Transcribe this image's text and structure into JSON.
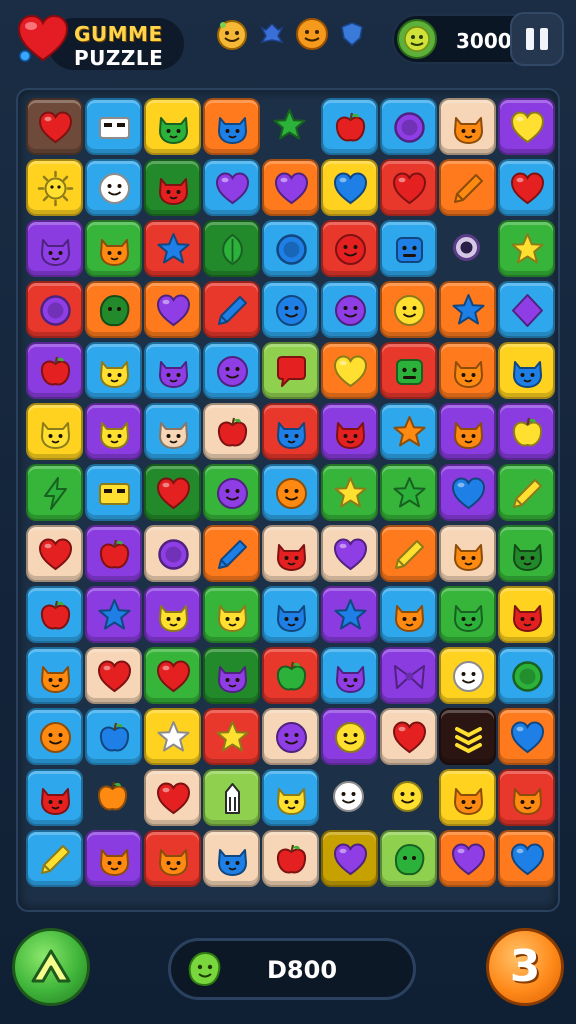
{
  "header": {
    "logo_line1": "GUMME",
    "logo_line2": "PUZZLE",
    "score": "3000",
    "top_icons": [
      "smiley-icon",
      "gem-icon",
      "smiley-icon",
      "shield-icon"
    ]
  },
  "footer": {
    "score": "D800",
    "moves": "3"
  },
  "colors": {
    "bg": "#14263b",
    "board": "#1c3047",
    "tile_palette": {
      "R": "#e8372b",
      "O": "#ff7a1c",
      "Y": "#ffd21f",
      "G": "#36b53a",
      "DG": "#238a2b",
      "B": "#2fa7ec",
      "P": "#8a3ce0",
      "C": "#f6d6b6",
      "Br": "#6e4a3a",
      "Bk": "#2a1512",
      "Ol": "#c7a100",
      "LG": "#8fd14f"
    },
    "icon_palette": {
      "R": "#e52020",
      "O": "#ff8a12",
      "Y": "#ffe030",
      "G": "#2cb13a",
      "B": "#1e80e6",
      "P": "#8f3ee6",
      "K": "#c8ffb5",
      "W": "#ffffff",
      "Bk": "#2b2b2b"
    }
  },
  "board": {
    "rows": [
      [
        [
          "Br",
          "heart",
          "R"
        ],
        [
          "B",
          "box",
          "W"
        ],
        [
          "Y",
          "cat",
          "G"
        ],
        [
          "O",
          "cat",
          "B"
        ],
        [
          "E",
          "star",
          "G"
        ],
        [
          "B",
          "apple",
          "R"
        ],
        [
          "B",
          "circle",
          "P"
        ],
        [
          "C",
          "cat",
          "O"
        ],
        [
          "P",
          "heart",
          "Y"
        ]
      ],
      [
        [
          "Y",
          "sun",
          "Y"
        ],
        [
          "B",
          "face",
          "W"
        ],
        [
          "DG",
          "cat",
          "R"
        ],
        [
          "B",
          "heart",
          "P"
        ],
        [
          "O",
          "heart",
          "P"
        ],
        [
          "Y",
          "heart",
          "B"
        ],
        [
          "R",
          "heart",
          "R"
        ],
        [
          "O",
          "pencil",
          "O"
        ],
        [
          "B",
          "heart",
          "R"
        ]
      ],
      [
        [
          "P",
          "cat",
          "P"
        ],
        [
          "G",
          "cat",
          "O"
        ],
        [
          "R",
          "star",
          "B"
        ],
        [
          "DG",
          "leaf",
          "G"
        ],
        [
          "B",
          "circle",
          "B"
        ],
        [
          "R",
          "face",
          "R"
        ],
        [
          "B",
          "robot",
          "B"
        ],
        [
          "E",
          "ring",
          "W"
        ],
        [
          "G",
          "star",
          "Y"
        ]
      ],
      [
        [
          "R",
          "circle",
          "P"
        ],
        [
          "O",
          "blob",
          "DG"
        ],
        [
          "O",
          "heart",
          "P"
        ],
        [
          "R",
          "pencil",
          "B"
        ],
        [
          "B",
          "face",
          "B"
        ],
        [
          "B",
          "face",
          "P"
        ],
        [
          "O",
          "face",
          "Y"
        ],
        [
          "O",
          "star",
          "B"
        ],
        [
          "B",
          "diamond",
          "P"
        ]
      ],
      [
        [
          "P",
          "apple",
          "R"
        ],
        [
          "B",
          "cat",
          "Y"
        ],
        [
          "B",
          "cat",
          "P"
        ],
        [
          "B",
          "face",
          "P"
        ],
        [
          "LG",
          "bubble",
          "R"
        ],
        [
          "O",
          "heart",
          "Y"
        ],
        [
          "R",
          "robot",
          "G"
        ],
        [
          "O",
          "cat",
          "O"
        ],
        [
          "Y",
          "cat",
          "B"
        ]
      ],
      [
        [
          "Y",
          "cat",
          "Y"
        ],
        [
          "P",
          "cat",
          "Y"
        ],
        [
          "B",
          "cat",
          "C"
        ],
        [
          "C",
          "apple",
          "R"
        ],
        [
          "R",
          "cat",
          "B"
        ],
        [
          "P",
          "cat",
          "R"
        ],
        [
          "B",
          "star",
          "O"
        ],
        [
          "P",
          "cat",
          "O"
        ],
        [
          "P",
          "apple",
          "Y"
        ]
      ],
      [
        [
          "G",
          "bolt",
          "G"
        ],
        [
          "B",
          "box",
          "Y"
        ],
        [
          "DG",
          "heart",
          "R"
        ],
        [
          "G",
          "face",
          "P"
        ],
        [
          "B",
          "face",
          "O"
        ],
        [
          "G",
          "star",
          "Y"
        ],
        [
          "G",
          "star",
          "G"
        ],
        [
          "P",
          "heart",
          "B"
        ],
        [
          "G",
          "pencil",
          "Y"
        ]
      ],
      [
        [
          "C",
          "heart",
          "R"
        ],
        [
          "P",
          "apple",
          "R"
        ],
        [
          "C",
          "circle",
          "P"
        ],
        [
          "O",
          "pencil",
          "B"
        ],
        [
          "C",
          "cat",
          "R"
        ],
        [
          "C",
          "heart",
          "P"
        ],
        [
          "O",
          "pencil",
          "Y"
        ],
        [
          "C",
          "cat",
          "O"
        ],
        [
          "G",
          "cat",
          "DG"
        ]
      ],
      [
        [
          "B",
          "apple",
          "R"
        ],
        [
          "P",
          "star",
          "B"
        ],
        [
          "P",
          "cat",
          "Y"
        ],
        [
          "G",
          "cat",
          "Y"
        ],
        [
          "B",
          "cat",
          "B"
        ],
        [
          "P",
          "star",
          "B"
        ],
        [
          "B",
          "cat",
          "O"
        ],
        [
          "G",
          "cat",
          "G"
        ],
        [
          "Y",
          "cat",
          "R"
        ]
      ],
      [
        [
          "B",
          "cat",
          "O"
        ],
        [
          "C",
          "heart",
          "R"
        ],
        [
          "G",
          "heart",
          "R"
        ],
        [
          "DG",
          "cat",
          "P"
        ],
        [
          "R",
          "apple",
          "G"
        ],
        [
          "B",
          "cat",
          "P"
        ],
        [
          "P",
          "bow",
          "P"
        ],
        [
          "Y",
          "face",
          "W"
        ],
        [
          "B",
          "circle",
          "G"
        ]
      ],
      [
        [
          "B",
          "face",
          "O"
        ],
        [
          "B",
          "apple",
          "B"
        ],
        [
          "Y",
          "star",
          "W"
        ],
        [
          "R",
          "star",
          "Y"
        ],
        [
          "C",
          "face",
          "P"
        ],
        [
          "P",
          "face",
          "Y"
        ],
        [
          "C",
          "heart",
          "R"
        ],
        [
          "Bk",
          "stripes",
          "Y"
        ],
        [
          "O",
          "heart",
          "B"
        ]
      ],
      [
        [
          "B",
          "cat",
          "R"
        ],
        [
          "E",
          "apple",
          "O"
        ],
        [
          "C",
          "heart",
          "R"
        ],
        [
          "LG",
          "tower",
          "W"
        ],
        [
          "B",
          "cat",
          "Y"
        ],
        [
          "E",
          "face",
          "W"
        ],
        [
          "E",
          "face",
          "Y"
        ],
        [
          "Y",
          "cat",
          "O"
        ],
        [
          "R",
          "cat",
          "O"
        ]
      ],
      [
        [
          "B",
          "pencil",
          "Y"
        ],
        [
          "P",
          "cat",
          "O"
        ],
        [
          "R",
          "cat",
          "O"
        ],
        [
          "C",
          "cat",
          "B"
        ],
        [
          "C",
          "apple",
          "R"
        ],
        [
          "Ol",
          "heart",
          "P"
        ],
        [
          "LG",
          "blob",
          "G"
        ],
        [
          "O",
          "heart",
          "P"
        ],
        [
          "O",
          "heart",
          "B"
        ]
      ]
    ]
  }
}
